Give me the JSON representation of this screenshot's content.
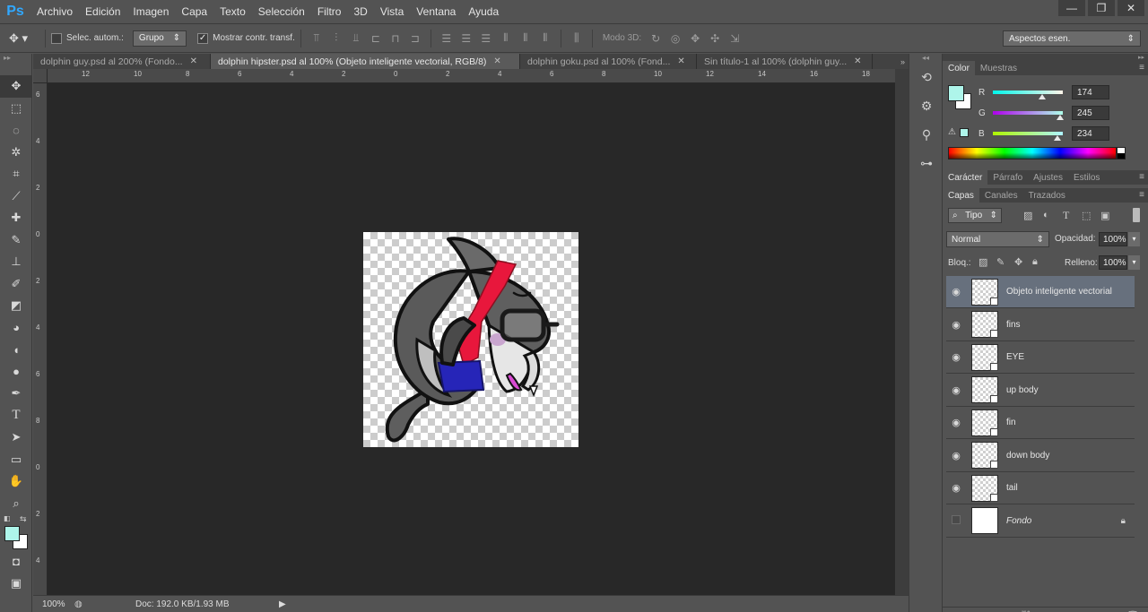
{
  "app": {
    "logo": "Ps"
  },
  "menu": [
    "Archivo",
    "Edición",
    "Imagen",
    "Capa",
    "Texto",
    "Selección",
    "Filtro",
    "3D",
    "Vista",
    "Ventana",
    "Ayuda"
  ],
  "window_controls": [
    "minimize-icon",
    "restore-icon",
    "close-icon"
  ],
  "options": {
    "auto_select_label": "Selec. autom.:",
    "auto_select_checked": false,
    "group_value": "Grupo",
    "show_transform_label": "Mostrar contr. transf.",
    "show_transform_checked": true,
    "mode3d_label": "Modo 3D:",
    "workspace_value": "Aspectos esen."
  },
  "tabs": [
    {
      "label": "dolphin guy.psd al 200% (Fondo...",
      "active": false
    },
    {
      "label": "dolphin hipster.psd al 100% (Objeto inteligente vectorial, RGB/8)",
      "active": true
    },
    {
      "label": "dolphin goku.psd al 100% (Fond...",
      "active": false
    },
    {
      "label": "Sin título-1 al 100% (dolphin guy...",
      "active": false
    }
  ],
  "ruler_h": [
    "12",
    "10",
    "8",
    "6",
    "4",
    "2",
    "0",
    "2",
    "4",
    "6",
    "8",
    "10",
    "12",
    "14",
    "16",
    "18"
  ],
  "ruler_v": [
    "6",
    "4",
    "2",
    "0",
    "2",
    "4",
    "6",
    "8",
    "0",
    "2",
    "4"
  ],
  "status": {
    "zoom": "100%",
    "doc": "Doc: 192.0 KB/1.93 MB"
  },
  "color_panel": {
    "tabs": [
      "Color",
      "Muestras"
    ],
    "r": 174,
    "g": 245,
    "b": 234,
    "r_label": "R",
    "g_label": "G",
    "b_label": "B",
    "foreground": "#aef5ea",
    "background": "#ffffff"
  },
  "character_panel": {
    "tabs": [
      "Carácter",
      "Párrafo",
      "Ajustes",
      "Estilos"
    ]
  },
  "layers_panel": {
    "tabs": [
      "Capas",
      "Canales",
      "Trazados"
    ],
    "filter_kind": "Tipo",
    "blend_mode": "Normal",
    "opacity_label": "Opacidad:",
    "opacity_value": "100%",
    "lock_label": "Bloq.:",
    "fill_label": "Relleno:",
    "fill_value": "100%",
    "layers": [
      {
        "name": "Objeto inteligente vectorial",
        "visible": true,
        "selected": true,
        "smart": true
      },
      {
        "name": "fins",
        "visible": true,
        "selected": false,
        "smart": true
      },
      {
        "name": "EYE",
        "visible": true,
        "selected": false,
        "smart": true
      },
      {
        "name": "up body",
        "visible": true,
        "selected": false,
        "smart": true
      },
      {
        "name": "fin",
        "visible": true,
        "selected": false,
        "smart": true
      },
      {
        "name": "down body",
        "visible": true,
        "selected": false,
        "smart": true
      },
      {
        "name": "tail",
        "visible": true,
        "selected": false,
        "smart": true
      },
      {
        "name": "Fondo",
        "visible": false,
        "selected": false,
        "smart": false,
        "locked": true
      }
    ]
  }
}
